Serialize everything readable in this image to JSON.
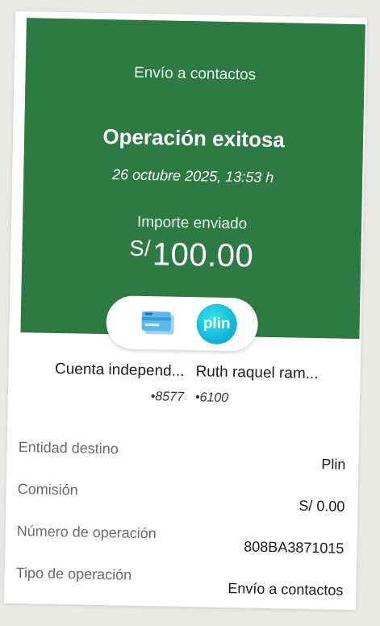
{
  "header": {
    "title": "Envío a contactos",
    "status": "Operación exitosa",
    "datetime": "26 octubre 2025, 13:53 h",
    "amount_label": "Importe enviado",
    "amount_currency": "S/",
    "amount_value": "100.00",
    "brand_color": "#2d7a45"
  },
  "apps": {
    "card_icon": "bbva-card-icon",
    "plin_label": "plin"
  },
  "parties": {
    "from_name": "Cuenta independ...",
    "from_account": "•8577",
    "to_name": "Ruth raquel ram...",
    "to_account": "•6100"
  },
  "details": [
    {
      "label": "Entidad destino",
      "value": "Plin"
    },
    {
      "label": "Comisión",
      "value": "S/ 0.00"
    },
    {
      "label": "Número de operación",
      "value": "808BA3871015"
    },
    {
      "label": "Tipo de operación",
      "value": "Envío a contactos"
    }
  ]
}
